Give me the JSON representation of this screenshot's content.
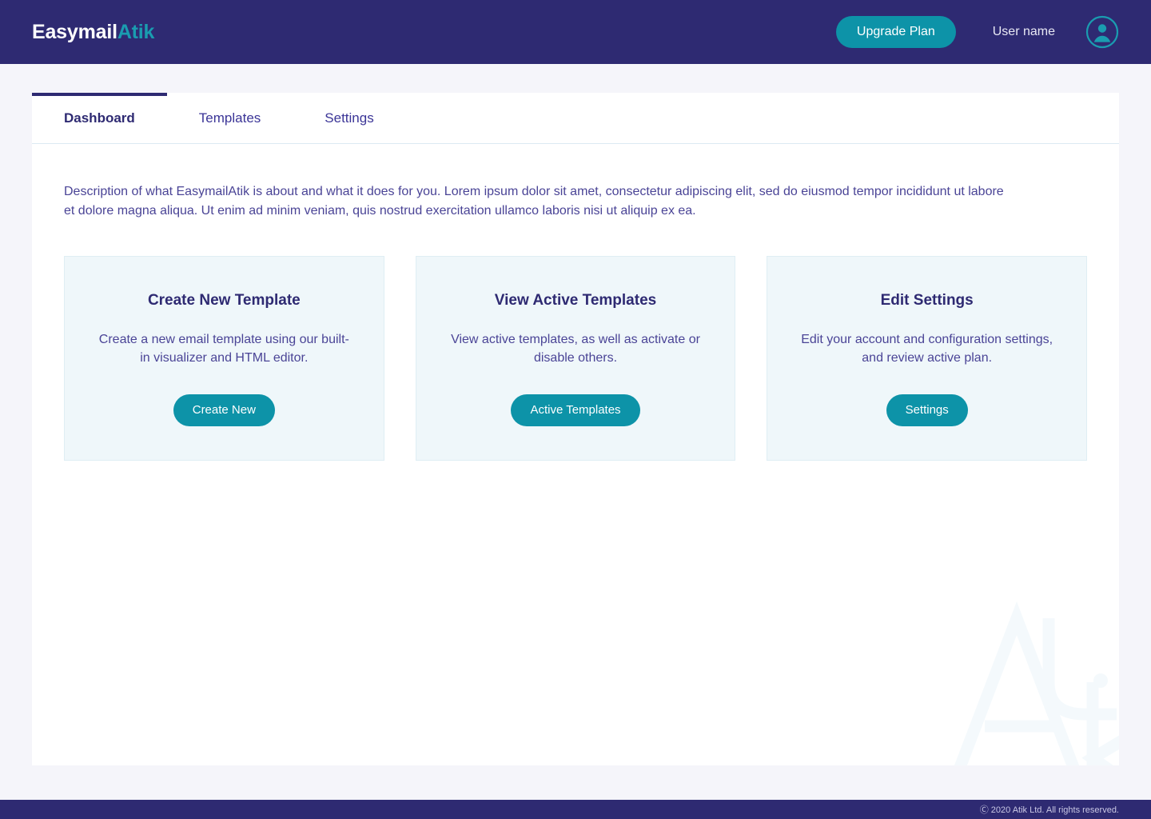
{
  "brand": {
    "logo_primary": "Easymail",
    "logo_accent": "Atik",
    "accent_color": "#0d93a8",
    "navy_color": "#2e2a72",
    "card_bg_color": "#eff7fa",
    "page_bg_color": "#f5f5fa"
  },
  "topbar": {
    "upgrade_label": "Upgrade Plan",
    "user_name": "User name",
    "avatar_icon": "user-circle-icon"
  },
  "tabs": [
    {
      "label": "Dashboard",
      "active": true
    },
    {
      "label": "Templates",
      "active": false
    },
    {
      "label": "Settings",
      "active": false
    }
  ],
  "main": {
    "description": "Description of what EasymailAtik is about and what it does for you. Lorem ipsum dolor sit amet, consectetur adipiscing elit, sed do eiusmod tempor incididunt ut labore et dolore magna aliqua. Ut enim ad minim veniam, quis nostrud exercitation ullamco laboris nisi ut aliquip ex ea.",
    "cards": [
      {
        "title": "Create New Template",
        "description": "Create a new email template using our built-in visualizer and HTML editor.",
        "button_label": "Create New"
      },
      {
        "title": "View Active Templates",
        "description": "View active templates, as well as activate or disable others.",
        "button_label": "Active Templates"
      },
      {
        "title": "Edit Settings",
        "description": "Edit your account and configuration settings, and review active plan.",
        "button_label": "Settings"
      }
    ]
  },
  "footer": {
    "copyright": "Ⓒ 2020 Atik Ltd. All rights reserved."
  }
}
